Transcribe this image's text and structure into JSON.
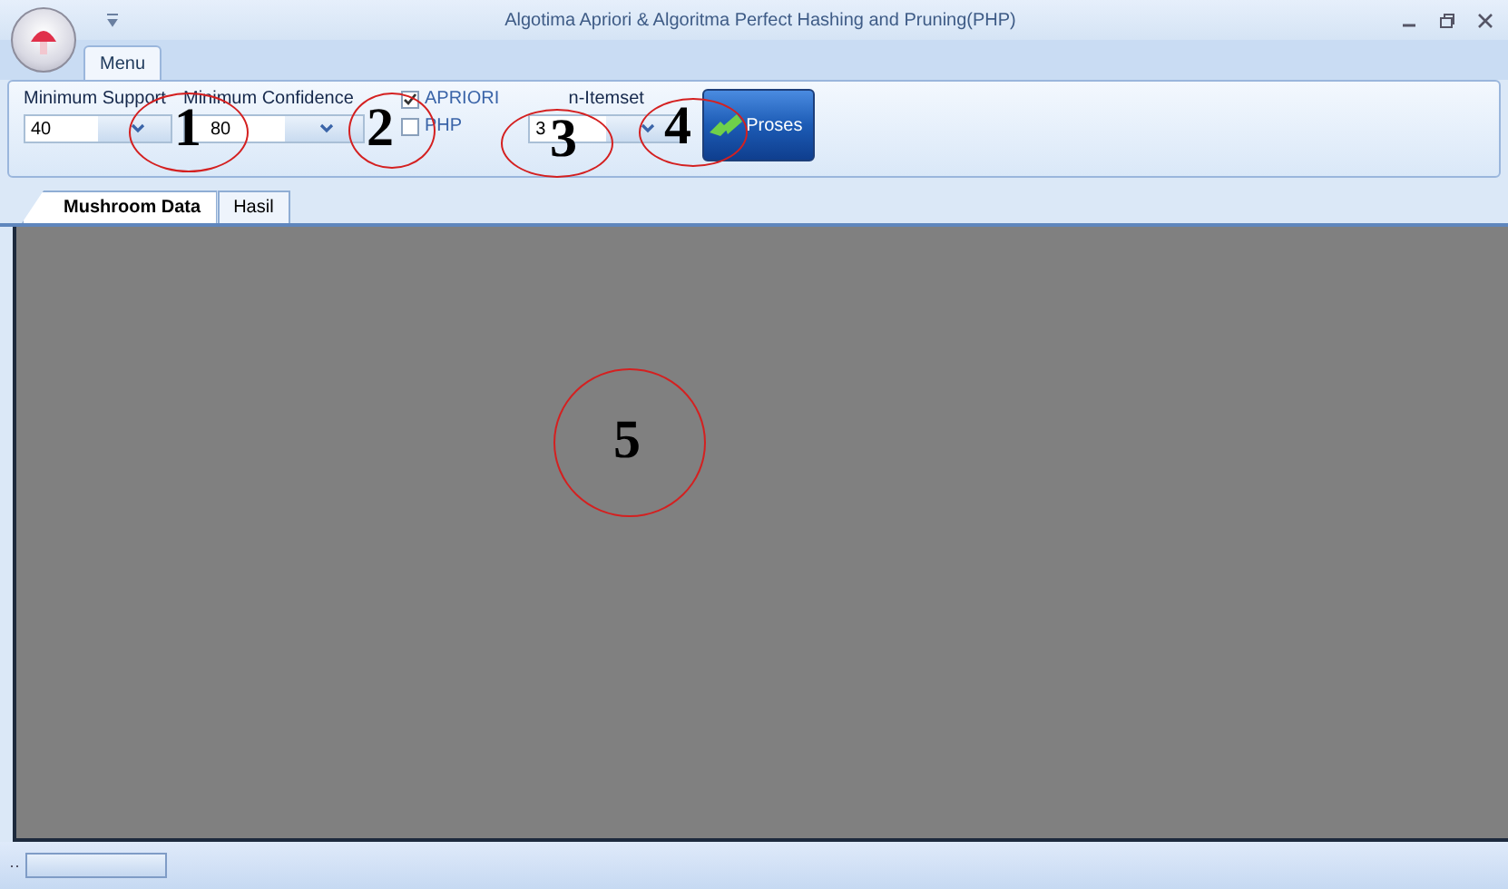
{
  "window": {
    "title": "Algotima Apriori & Algoritma Perfect Hashing and Pruning(PHP)"
  },
  "ribbon_tabs": [
    {
      "label": "Menu",
      "selected": true
    }
  ],
  "ribbon": {
    "min_support": {
      "label": "Minimum Support",
      "value": "40"
    },
    "min_confidence": {
      "label": "Minimum Confidence",
      "value": "80"
    },
    "algorithms": [
      {
        "label": "APRIORI",
        "checked": true
      },
      {
        "label": "PHP",
        "checked": false
      }
    ],
    "itemset": {
      "label": "n-Itemset",
      "value": "3"
    },
    "run_button": {
      "label": "Proses"
    }
  },
  "tabs": [
    {
      "label": "Mushroom Data",
      "selected": true
    },
    {
      "label": "Hasil",
      "selected": false
    }
  ],
  "annotations": [
    {
      "label": "1"
    },
    {
      "label": "2"
    },
    {
      "label": "3"
    },
    {
      "label": "4"
    },
    {
      "label": "5"
    }
  ]
}
